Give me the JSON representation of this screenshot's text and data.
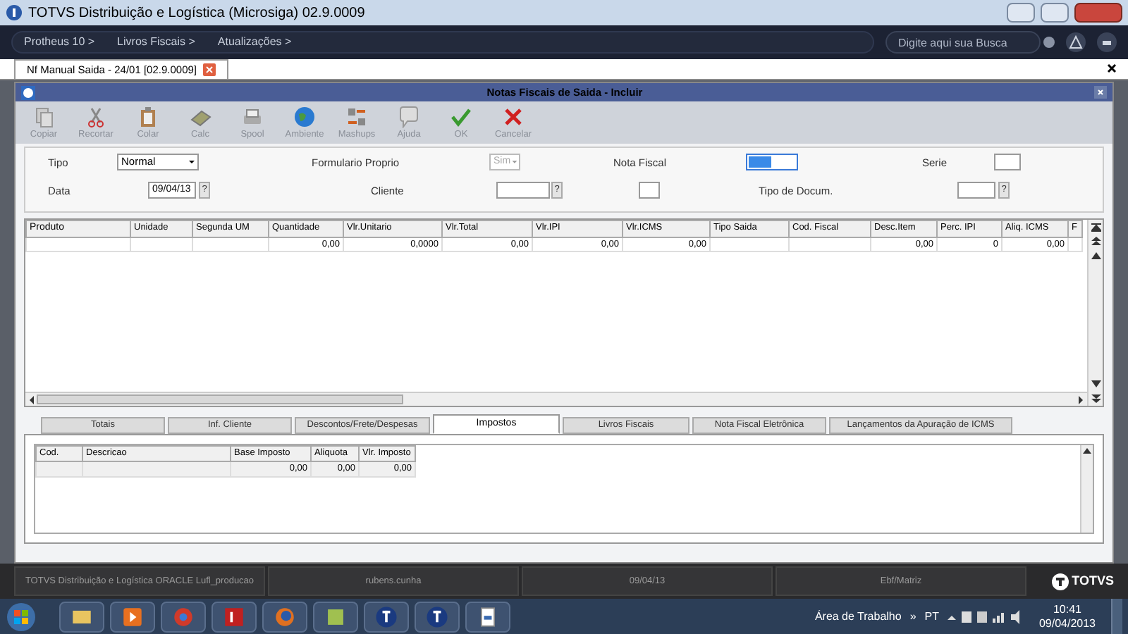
{
  "window": {
    "title": "TOTVS Distribuição e Logística (Microsiga) 02.9.0009"
  },
  "nav": {
    "breadcrumbs": [
      "Protheus 10 >",
      "Livros Fiscais >",
      "Atualizações >"
    ],
    "search": {
      "placeholder": "Digite aqui sua Busca"
    }
  },
  "doc_tab": {
    "label": "Nf Manual Saida - 24/01 [02.9.0009]"
  },
  "dialog": {
    "title": "Notas Fiscais de Saida - Incluir",
    "toolbar": [
      {
        "label": "Copiar",
        "kind": "copy"
      },
      {
        "label": "Recortar",
        "kind": "cut"
      },
      {
        "label": "Colar",
        "kind": "paste"
      },
      {
        "label": "Calc",
        "kind": "calc"
      },
      {
        "label": "Spool",
        "kind": "print"
      },
      {
        "label": "Ambiente",
        "kind": "globe"
      },
      {
        "label": "Mashups",
        "kind": "mashup"
      },
      {
        "label": "Ajuda",
        "kind": "help"
      },
      {
        "label": "OK",
        "kind": "ok"
      },
      {
        "label": "Cancelar",
        "kind": "cancel"
      }
    ],
    "form": {
      "tipo": {
        "label": "Tipo",
        "value": "Normal"
      },
      "formulario_proprio": {
        "label": "Formulario Proprio",
        "value": "Sim",
        "disabled": true
      },
      "nota_fiscal": {
        "label": "Nota Fiscal",
        "focused": true
      },
      "serie": {
        "label": "Serie"
      },
      "data": {
        "label": "Data",
        "value": "09/04/13",
        "lookup": "?"
      },
      "cliente": {
        "label": "Cliente",
        "lookup": "?"
      },
      "tipo_docum": {
        "label": "Tipo de Docum.",
        "lookup": "?"
      }
    },
    "items_grid": {
      "columns": [
        "Produto",
        "Unidade",
        "Segunda UM",
        "Quantidade",
        "Vlr.Unitario",
        "Vlr.Total",
        "Vlr.IPI",
        "Vlr.ICMS",
        "Tipo Saida",
        "Cod. Fiscal",
        "Desc.Item",
        "Perc. IPI",
        "Aliq. ICMS",
        "F"
      ],
      "rows": [
        [
          "",
          "",
          "",
          "0,00",
          "0,0000",
          "0,00",
          "0,00",
          "0,00",
          "",
          "",
          "0,00",
          "0",
          "0,00",
          ""
        ]
      ]
    },
    "tabs": [
      {
        "label": "Totais",
        "selected": false
      },
      {
        "label": "Inf. Cliente",
        "selected": false
      },
      {
        "label": "Descontos/Frete/Despesas",
        "selected": false
      },
      {
        "label": "Impostos",
        "selected": true
      },
      {
        "label": "Livros Fiscais",
        "selected": false
      },
      {
        "label": "Nota Fiscal Eletrônica",
        "selected": false
      },
      {
        "label": "Lançamentos da Apuração de ICMS",
        "selected": false
      }
    ],
    "tax_grid": {
      "columns": [
        "Cod.",
        "Descricao",
        "Base Imposto",
        "Aliquota",
        "Vlr. Imposto"
      ],
      "rows": [
        [
          "",
          "",
          "0,00",
          "0,00",
          "0,00"
        ]
      ]
    }
  },
  "status_bar": [
    "TOTVS Distribuição e Logística ORACLE Lufl_producao",
    "rubens.cunha",
    "09/04/13",
    "Ebf/Matriz"
  ],
  "status_logo": "TOTVS",
  "taskbar": {
    "desktop_label": "Área de Trabalho",
    "chevron": "»",
    "language": "PT",
    "time": "10:41",
    "date": "09/04/2013"
  }
}
